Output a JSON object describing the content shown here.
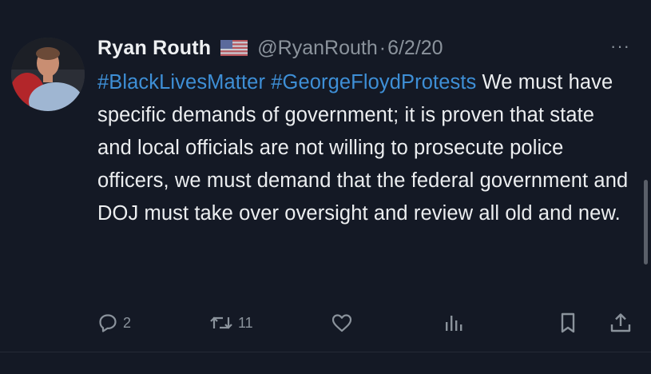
{
  "tweet": {
    "author_name": "Ryan Routh",
    "handle": "@RyanRouth",
    "separator": "·",
    "date": "6/2/20",
    "more_label": "···",
    "hashtags": [
      "#BlackLivesMatter",
      "#GeorgeFloydProtests"
    ],
    "text": "We must have specific demands of government; it is proven that state and local officials are not willing to prosecute police officers, we must demand that the federal government and DOJ must take over oversight and review all old and new."
  },
  "actions": {
    "reply_count": "2",
    "retweet_count": "11",
    "reply_icon": "reply-icon",
    "retweet_icon": "retweet-icon",
    "like_icon": "heart-icon",
    "views_icon": "views-icon",
    "bookmark_icon": "bookmark-icon",
    "share_icon": "share-icon"
  },
  "colors": {
    "background": "#141925",
    "hashtag": "#3e8fd6",
    "muted": "#8b939c",
    "text": "#eceef0"
  }
}
